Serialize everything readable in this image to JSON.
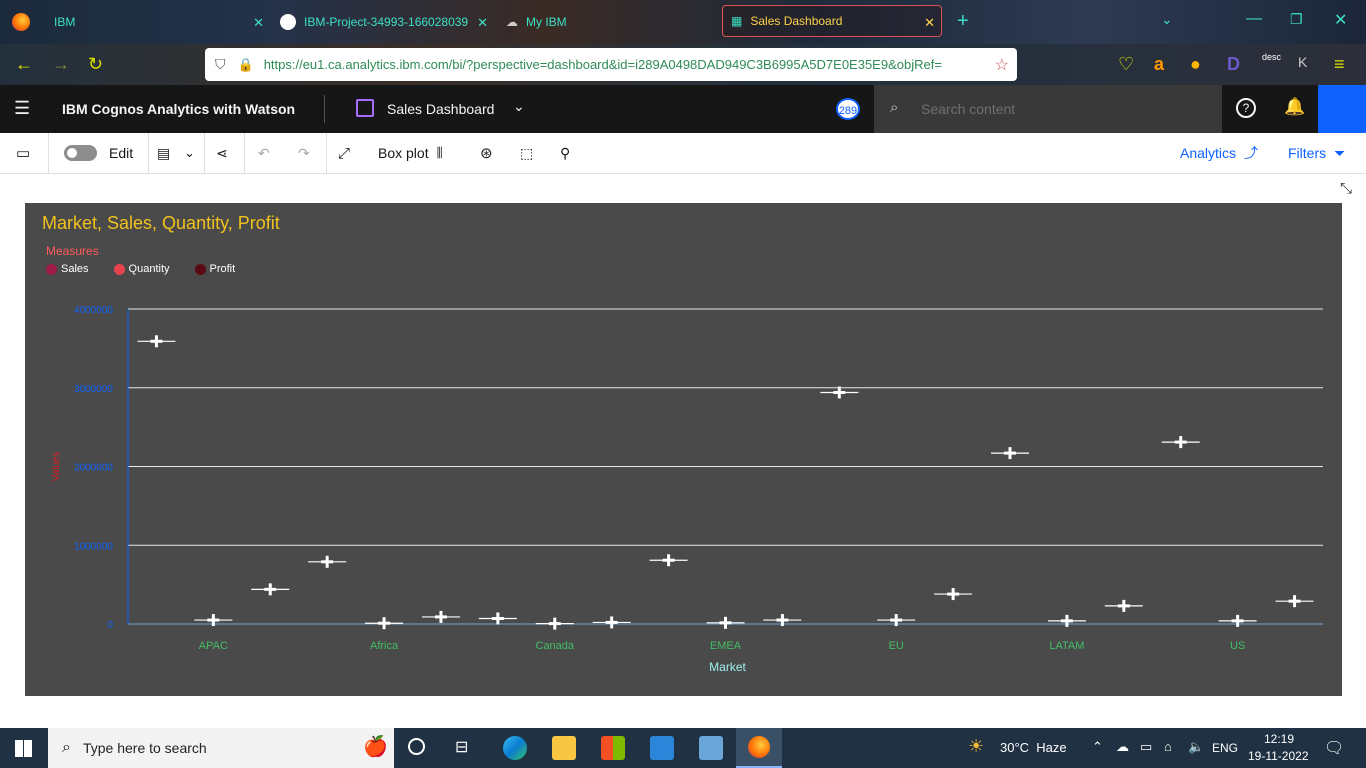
{
  "browser": {
    "tabs": [
      {
        "title": "IBM"
      },
      {
        "title": "IBM-Project-34993-166028039"
      },
      {
        "title": "My IBM"
      },
      {
        "title": "Sales Dashboard"
      }
    ],
    "url": "https://eu1.ca.analytics.ibm.com/bi/?perspective=dashboard&id=i289A0498DAD949C3B6995A5D7E0E35E9&objRef=",
    "ext_label": "desc"
  },
  "app": {
    "product_name": "IBM Cognos Analytics with Watson",
    "dashboard_name": "Sales Dashboard",
    "badge_count": "289",
    "search_placeholder": "Search content"
  },
  "toolbar": {
    "edit_label": "Edit",
    "viz_type_label": "Box plot",
    "analytics_label": "Analytics",
    "filters_label": "Filters"
  },
  "chart_data": {
    "type": "boxplot",
    "title": "Market, Sales, Quantity, Profit",
    "legend_title": "Measures",
    "legend": [
      {
        "name": "Sales",
        "color": "#9e1b45"
      },
      {
        "name": "Quantity",
        "color": "#e8424f"
      },
      {
        "name": "Profit",
        "color": "#5a0a14"
      }
    ],
    "xlabel": "Market",
    "ylabel": "Values",
    "ylim": [
      0,
      4000000
    ],
    "yticks": [
      "0",
      "1000000",
      "2000000",
      "3000000",
      "4000000"
    ],
    "categories": [
      "APAC",
      "Africa",
      "Canada",
      "EMEA",
      "EU",
      "LATAM",
      "US"
    ],
    "series": [
      {
        "name": "Sales",
        "values": [
          3590000,
          790000,
          70000,
          810000,
          2940000,
          2170000,
          2310000
        ]
      },
      {
        "name": "Quantity",
        "values": [
          50000,
          10000,
          5000,
          15000,
          50000,
          40000,
          40000
        ]
      },
      {
        "name": "Profit",
        "values": [
          440000,
          90000,
          20000,
          50000,
          380000,
          230000,
          290000
        ]
      }
    ],
    "grid": true
  },
  "taskbar": {
    "search_placeholder": "Type here to search",
    "weather": "30°C  Haze",
    "language": "ENG",
    "time": "12:19",
    "date": "19-11-2022"
  }
}
